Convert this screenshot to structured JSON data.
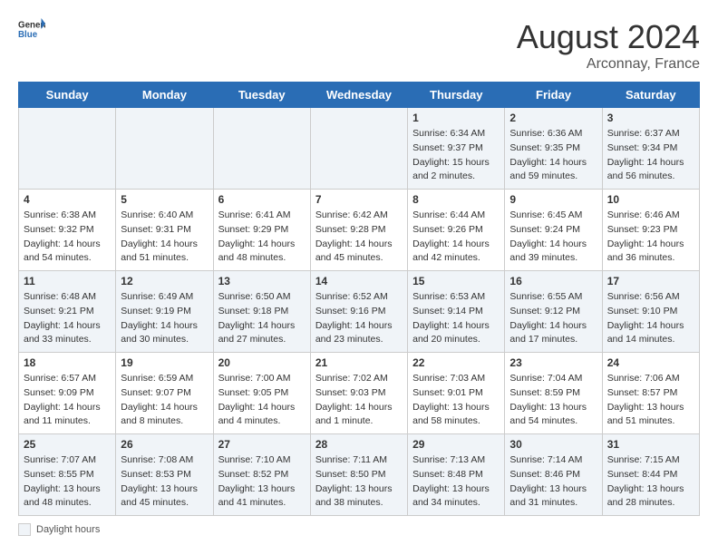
{
  "header": {
    "logo_general": "General",
    "logo_blue": "Blue",
    "month_year": "August 2024",
    "location": "Arconnay, France"
  },
  "weekdays": [
    "Sunday",
    "Monday",
    "Tuesday",
    "Wednesday",
    "Thursday",
    "Friday",
    "Saturday"
  ],
  "footer": {
    "daylight_label": "Daylight hours"
  },
  "weeks": [
    [
      {
        "day": "",
        "sunrise": "",
        "sunset": "",
        "daylight": ""
      },
      {
        "day": "",
        "sunrise": "",
        "sunset": "",
        "daylight": ""
      },
      {
        "day": "",
        "sunrise": "",
        "sunset": "",
        "daylight": ""
      },
      {
        "day": "",
        "sunrise": "",
        "sunset": "",
        "daylight": ""
      },
      {
        "day": "1",
        "sunrise": "Sunrise: 6:34 AM",
        "sunset": "Sunset: 9:37 PM",
        "daylight": "Daylight: 15 hours and 2 minutes."
      },
      {
        "day": "2",
        "sunrise": "Sunrise: 6:36 AM",
        "sunset": "Sunset: 9:35 PM",
        "daylight": "Daylight: 14 hours and 59 minutes."
      },
      {
        "day": "3",
        "sunrise": "Sunrise: 6:37 AM",
        "sunset": "Sunset: 9:34 PM",
        "daylight": "Daylight: 14 hours and 56 minutes."
      }
    ],
    [
      {
        "day": "4",
        "sunrise": "Sunrise: 6:38 AM",
        "sunset": "Sunset: 9:32 PM",
        "daylight": "Daylight: 14 hours and 54 minutes."
      },
      {
        "day": "5",
        "sunrise": "Sunrise: 6:40 AM",
        "sunset": "Sunset: 9:31 PM",
        "daylight": "Daylight: 14 hours and 51 minutes."
      },
      {
        "day": "6",
        "sunrise": "Sunrise: 6:41 AM",
        "sunset": "Sunset: 9:29 PM",
        "daylight": "Daylight: 14 hours and 48 minutes."
      },
      {
        "day": "7",
        "sunrise": "Sunrise: 6:42 AM",
        "sunset": "Sunset: 9:28 PM",
        "daylight": "Daylight: 14 hours and 45 minutes."
      },
      {
        "day": "8",
        "sunrise": "Sunrise: 6:44 AM",
        "sunset": "Sunset: 9:26 PM",
        "daylight": "Daylight: 14 hours and 42 minutes."
      },
      {
        "day": "9",
        "sunrise": "Sunrise: 6:45 AM",
        "sunset": "Sunset: 9:24 PM",
        "daylight": "Daylight: 14 hours and 39 minutes."
      },
      {
        "day": "10",
        "sunrise": "Sunrise: 6:46 AM",
        "sunset": "Sunset: 9:23 PM",
        "daylight": "Daylight: 14 hours and 36 minutes."
      }
    ],
    [
      {
        "day": "11",
        "sunrise": "Sunrise: 6:48 AM",
        "sunset": "Sunset: 9:21 PM",
        "daylight": "Daylight: 14 hours and 33 minutes."
      },
      {
        "day": "12",
        "sunrise": "Sunrise: 6:49 AM",
        "sunset": "Sunset: 9:19 PM",
        "daylight": "Daylight: 14 hours and 30 minutes."
      },
      {
        "day": "13",
        "sunrise": "Sunrise: 6:50 AM",
        "sunset": "Sunset: 9:18 PM",
        "daylight": "Daylight: 14 hours and 27 minutes."
      },
      {
        "day": "14",
        "sunrise": "Sunrise: 6:52 AM",
        "sunset": "Sunset: 9:16 PM",
        "daylight": "Daylight: 14 hours and 23 minutes."
      },
      {
        "day": "15",
        "sunrise": "Sunrise: 6:53 AM",
        "sunset": "Sunset: 9:14 PM",
        "daylight": "Daylight: 14 hours and 20 minutes."
      },
      {
        "day": "16",
        "sunrise": "Sunrise: 6:55 AM",
        "sunset": "Sunset: 9:12 PM",
        "daylight": "Daylight: 14 hours and 17 minutes."
      },
      {
        "day": "17",
        "sunrise": "Sunrise: 6:56 AM",
        "sunset": "Sunset: 9:10 PM",
        "daylight": "Daylight: 14 hours and 14 minutes."
      }
    ],
    [
      {
        "day": "18",
        "sunrise": "Sunrise: 6:57 AM",
        "sunset": "Sunset: 9:09 PM",
        "daylight": "Daylight: 14 hours and 11 minutes."
      },
      {
        "day": "19",
        "sunrise": "Sunrise: 6:59 AM",
        "sunset": "Sunset: 9:07 PM",
        "daylight": "Daylight: 14 hours and 8 minutes."
      },
      {
        "day": "20",
        "sunrise": "Sunrise: 7:00 AM",
        "sunset": "Sunset: 9:05 PM",
        "daylight": "Daylight: 14 hours and 4 minutes."
      },
      {
        "day": "21",
        "sunrise": "Sunrise: 7:02 AM",
        "sunset": "Sunset: 9:03 PM",
        "daylight": "Daylight: 14 hours and 1 minute."
      },
      {
        "day": "22",
        "sunrise": "Sunrise: 7:03 AM",
        "sunset": "Sunset: 9:01 PM",
        "daylight": "Daylight: 13 hours and 58 minutes."
      },
      {
        "day": "23",
        "sunrise": "Sunrise: 7:04 AM",
        "sunset": "Sunset: 8:59 PM",
        "daylight": "Daylight: 13 hours and 54 minutes."
      },
      {
        "day": "24",
        "sunrise": "Sunrise: 7:06 AM",
        "sunset": "Sunset: 8:57 PM",
        "daylight": "Daylight: 13 hours and 51 minutes."
      }
    ],
    [
      {
        "day": "25",
        "sunrise": "Sunrise: 7:07 AM",
        "sunset": "Sunset: 8:55 PM",
        "daylight": "Daylight: 13 hours and 48 minutes."
      },
      {
        "day": "26",
        "sunrise": "Sunrise: 7:08 AM",
        "sunset": "Sunset: 8:53 PM",
        "daylight": "Daylight: 13 hours and 45 minutes."
      },
      {
        "day": "27",
        "sunrise": "Sunrise: 7:10 AM",
        "sunset": "Sunset: 8:52 PM",
        "daylight": "Daylight: 13 hours and 41 minutes."
      },
      {
        "day": "28",
        "sunrise": "Sunrise: 7:11 AM",
        "sunset": "Sunset: 8:50 PM",
        "daylight": "Daylight: 13 hours and 38 minutes."
      },
      {
        "day": "29",
        "sunrise": "Sunrise: 7:13 AM",
        "sunset": "Sunset: 8:48 PM",
        "daylight": "Daylight: 13 hours and 34 minutes."
      },
      {
        "day": "30",
        "sunrise": "Sunrise: 7:14 AM",
        "sunset": "Sunset: 8:46 PM",
        "daylight": "Daylight: 13 hours and 31 minutes."
      },
      {
        "day": "31",
        "sunrise": "Sunrise: 7:15 AM",
        "sunset": "Sunset: 8:44 PM",
        "daylight": "Daylight: 13 hours and 28 minutes."
      }
    ]
  ]
}
